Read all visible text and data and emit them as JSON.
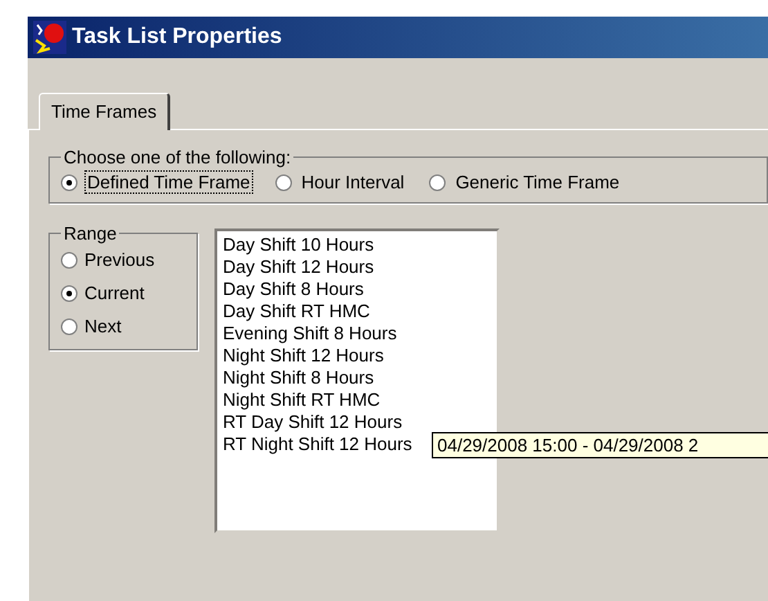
{
  "window": {
    "title": "Task List Properties"
  },
  "tabs": [
    {
      "label": "Time Frames",
      "selected": true
    }
  ],
  "choice_group": {
    "legend": "Choose one of the following:",
    "options": [
      {
        "label": "Defined Time Frame",
        "selected": true,
        "focused": true
      },
      {
        "label": "Hour Interval",
        "selected": false,
        "focused": false
      },
      {
        "label": "Generic Time Frame",
        "selected": false,
        "focused": false
      }
    ]
  },
  "range_group": {
    "legend": "Range",
    "options": [
      {
        "label": "Previous",
        "selected": false
      },
      {
        "label": "Current",
        "selected": true
      },
      {
        "label": "Next",
        "selected": false
      }
    ]
  },
  "time_frames": [
    "Day Shift 10 Hours",
    "Day Shift 12 Hours",
    "Day Shift 8 Hours",
    "Day Shift RT HMC",
    "Evening Shift 8 Hours",
    "Night Shift 12 Hours",
    "Night Shift 8 Hours",
    "Night Shift RT HMC",
    "RT Day Shift 12 Hours",
    "RT Night Shift 12 Hours"
  ],
  "tooltip": "04/29/2008 15:00 - 04/29/2008 2"
}
